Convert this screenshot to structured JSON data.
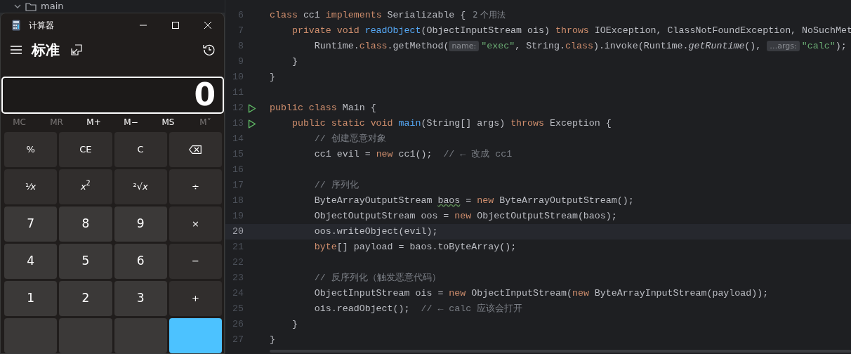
{
  "project_tree": {
    "folder": "main",
    "expanded": true
  },
  "calculator": {
    "title": "计算器",
    "mode": "标准",
    "display": "0",
    "memory": [
      {
        "label": "MC",
        "disabled": true
      },
      {
        "label": "MR",
        "disabled": true
      },
      {
        "label": "M+",
        "disabled": false
      },
      {
        "label": "M−",
        "disabled": false
      },
      {
        "label": "MS",
        "disabled": false
      },
      {
        "label": "M˅",
        "disabled": true
      }
    ],
    "keys": [
      [
        {
          "kind": "fn",
          "label": "%"
        },
        {
          "kind": "fn",
          "label": "CE"
        },
        {
          "kind": "fn",
          "label": "C"
        },
        {
          "kind": "backspace"
        }
      ],
      [
        {
          "kind": "fn",
          "label": "¹⁄*x*"
        },
        {
          "kind": "fn",
          "label": "*x*$^{2}$"
        },
        {
          "kind": "fn",
          "label": "²√*x*"
        },
        {
          "kind": "fn",
          "label": "÷"
        }
      ],
      [
        {
          "kind": "digit",
          "label": "7"
        },
        {
          "kind": "digit",
          "label": "8"
        },
        {
          "kind": "digit",
          "label": "9"
        },
        {
          "kind": "fn",
          "label": "×"
        }
      ],
      [
        {
          "kind": "digit",
          "label": "4"
        },
        {
          "kind": "digit",
          "label": "5"
        },
        {
          "kind": "digit",
          "label": "6"
        },
        {
          "kind": "fn",
          "label": "−"
        }
      ],
      [
        {
          "kind": "digit",
          "label": "1"
        },
        {
          "kind": "digit",
          "label": "2"
        },
        {
          "kind": "digit",
          "label": "3"
        },
        {
          "kind": "fn",
          "label": "+"
        }
      ],
      [
        {
          "kind": "digit"
        },
        {
          "kind": "digit"
        },
        {
          "kind": "digit"
        },
        {
          "kind": "accent"
        }
      ]
    ]
  },
  "editor": {
    "lines": [
      {
        "number": "6",
        "current": false,
        "run": false,
        "tokens": [
          {
            "kind": "keyword",
            "text": "class "
          },
          {
            "kind": "plain",
            "text": "cc1 "
          },
          {
            "kind": "keyword",
            "text": "implements "
          },
          {
            "kind": "plain",
            "text": "Serializable {"
          },
          {
            "kind": "usage",
            "text": "2 个用法"
          }
        ]
      },
      {
        "number": "7",
        "current": false,
        "run": false,
        "tokens": [
          {
            "kind": "keyword",
            "text": "    private void "
          },
          {
            "kind": "declaration",
            "text": "readObject"
          },
          {
            "kind": "plain",
            "text": "(ObjectInputStream ois) "
          },
          {
            "kind": "keyword",
            "text": "throws "
          },
          {
            "kind": "plain",
            "text": "IOException, ClassNotFoundException, NoSuchMet"
          }
        ]
      },
      {
        "number": "8",
        "current": false,
        "run": false,
        "tokens": [
          {
            "kind": "plain",
            "text": "        Runtime."
          },
          {
            "kind": "keyword",
            "text": "class"
          },
          {
            "kind": "plain",
            "text": ".getMethod("
          },
          {
            "kind": "hint",
            "text": "name:"
          },
          {
            "kind": "string",
            "text": "\"exec\""
          },
          {
            "kind": "plain",
            "text": ", String."
          },
          {
            "kind": "keyword",
            "text": "class"
          },
          {
            "kind": "plain",
            "text": ").invoke(Runtime."
          },
          {
            "kind": "italic",
            "text": "getRuntime"
          },
          {
            "kind": "plain",
            "text": "(), "
          },
          {
            "kind": "hint",
            "text": "…args:"
          },
          {
            "kind": "string",
            "text": "\"calc\""
          },
          {
            "kind": "plain",
            "text": ");"
          }
        ]
      },
      {
        "number": "9",
        "current": false,
        "run": false,
        "tokens": [
          {
            "kind": "plain",
            "text": "    }"
          }
        ]
      },
      {
        "number": "10",
        "current": false,
        "run": false,
        "tokens": [
          {
            "kind": "plain",
            "text": "}"
          }
        ]
      },
      {
        "number": "11",
        "current": false,
        "run": false
      },
      {
        "number": "12",
        "current": false,
        "run": true,
        "tokens": [
          {
            "kind": "keyword",
            "text": "public class "
          },
          {
            "kind": "plain",
            "text": "Main {"
          }
        ]
      },
      {
        "number": "13",
        "current": false,
        "run": true,
        "tokens": [
          {
            "kind": "keyword",
            "text": "    public static void "
          },
          {
            "kind": "declaration",
            "text": "main"
          },
          {
            "kind": "plain",
            "text": "(String[] args) "
          },
          {
            "kind": "keyword",
            "text": "throws "
          },
          {
            "kind": "plain",
            "text": "Exception {"
          }
        ]
      },
      {
        "number": "14",
        "current": false,
        "run": false,
        "tokens": [
          {
            "kind": "comment",
            "text": "        // 创建恶意对象"
          }
        ]
      },
      {
        "number": "15",
        "current": false,
        "run": false,
        "tokens": [
          {
            "kind": "plain",
            "text": "        cc1 evil = "
          },
          {
            "kind": "keyword",
            "text": "new "
          },
          {
            "kind": "plain",
            "text": "cc1();  "
          },
          {
            "kind": "comment",
            "text": "// ← 改成 cc1"
          }
        ]
      },
      {
        "number": "16",
        "current": false,
        "run": false
      },
      {
        "number": "17",
        "current": false,
        "run": false,
        "tokens": [
          {
            "kind": "comment",
            "text": "        // 序列化"
          }
        ]
      },
      {
        "number": "18",
        "current": false,
        "run": false,
        "tokens": [
          {
            "kind": "plain",
            "text": "        ByteArrayOutputStream "
          },
          {
            "kind": "warning",
            "text": "baos"
          },
          {
            "kind": "plain",
            "text": " = "
          },
          {
            "kind": "keyword",
            "text": "new "
          },
          {
            "kind": "plain",
            "text": "ByteArrayOutputStream();"
          }
        ]
      },
      {
        "number": "19",
        "current": false,
        "run": false,
        "tokens": [
          {
            "kind": "plain",
            "text": "        ObjectOutputStream oos = "
          },
          {
            "kind": "keyword",
            "text": "new "
          },
          {
            "kind": "plain",
            "text": "ObjectOutputStream(baos);"
          }
        ]
      },
      {
        "number": "20",
        "current": true,
        "run": false,
        "tokens": [
          {
            "kind": "plain",
            "text": "        oos.writeObject(evil);"
          }
        ]
      },
      {
        "number": "21",
        "current": false,
        "run": false,
        "tokens": [
          {
            "kind": "keyword",
            "text": "        byte"
          },
          {
            "kind": "plain",
            "text": "[] payload = baos.toByteArray();"
          }
        ]
      },
      {
        "number": "22",
        "current": false,
        "run": false
      },
      {
        "number": "23",
        "current": false,
        "run": false,
        "tokens": [
          {
            "kind": "comment",
            "text": "        // 反序列化（触发恶意代码）"
          }
        ]
      },
      {
        "number": "24",
        "current": false,
        "run": false,
        "tokens": [
          {
            "kind": "plain",
            "text": "        ObjectInputStream ois = "
          },
          {
            "kind": "keyword",
            "text": "new "
          },
          {
            "kind": "plain",
            "text": "ObjectInputStream("
          },
          {
            "kind": "keyword",
            "text": "new "
          },
          {
            "kind": "plain",
            "text": "ByteArrayInputStream(payload));"
          }
        ]
      },
      {
        "number": "25",
        "current": false,
        "run": false,
        "tokens": [
          {
            "kind": "plain",
            "text": "        ois.readObject();  "
          },
          {
            "kind": "comment",
            "text": "// ← calc 应该会打开"
          }
        ]
      },
      {
        "number": "26",
        "current": false,
        "run": false,
        "tokens": [
          {
            "kind": "plain",
            "text": "    }"
          }
        ]
      },
      {
        "number": "27",
        "current": false,
        "run": false,
        "tokens": [
          {
            "kind": "plain",
            "text": "}"
          }
        ]
      }
    ]
  }
}
